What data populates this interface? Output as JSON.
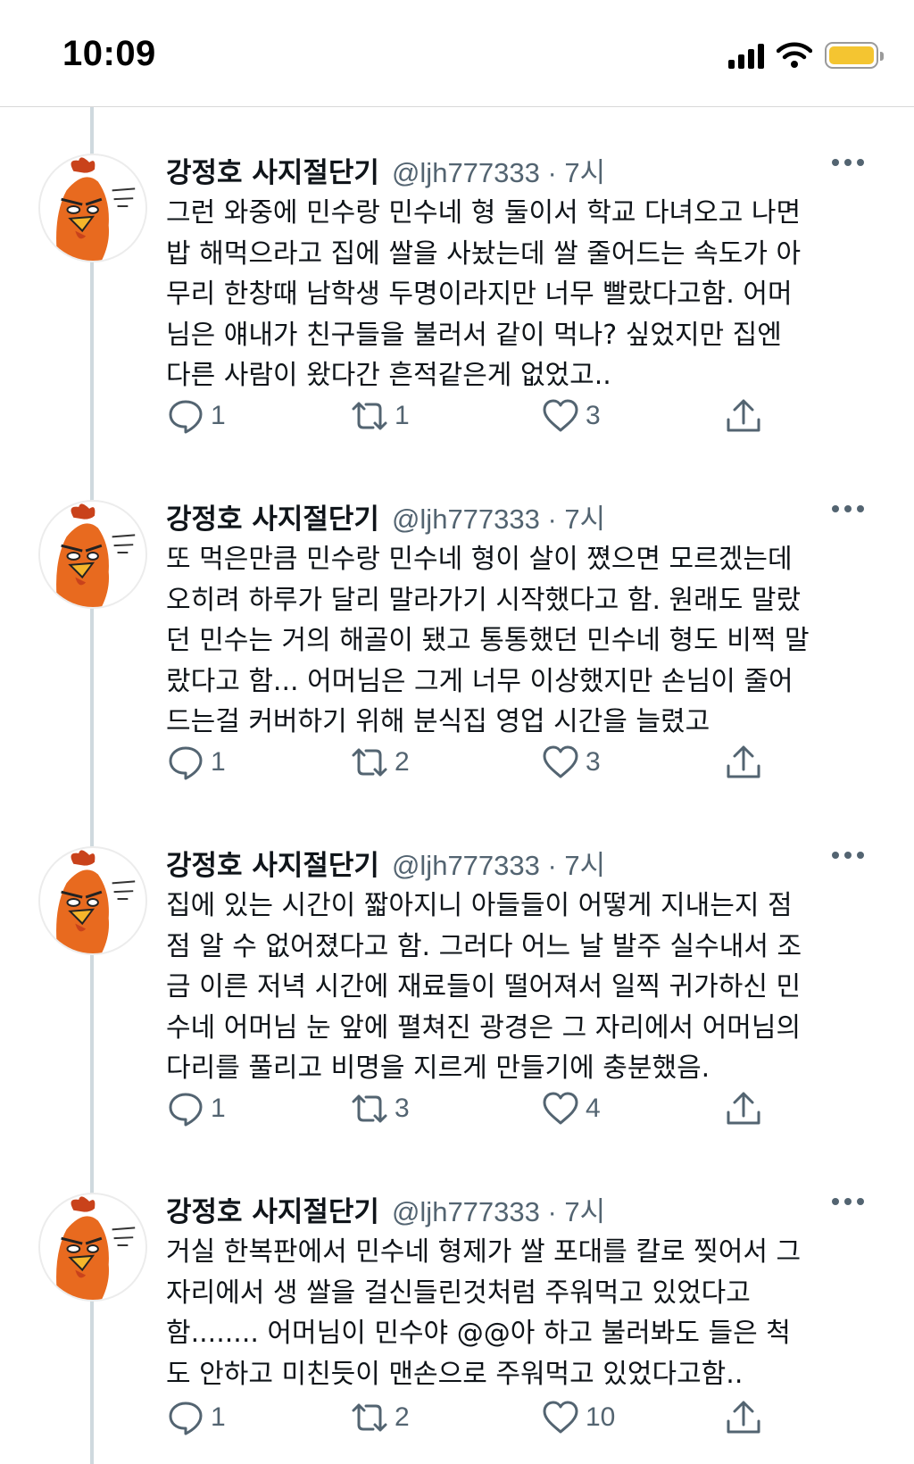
{
  "status_bar": {
    "time": "10:09",
    "battery_color": "#f4c531"
  },
  "colors": {
    "text": "#0f1419",
    "secondary": "#536471",
    "thread_line": "#cfd9de",
    "avatar_bird": "#e86a1f"
  },
  "tweets": [
    {
      "display_name": "강정호 사지절단기",
      "handle_time": "@ljh777333 · 7시",
      "text": "그런 와중에 민수랑 민수네 형 둘이서 학교 다녀오고 나면\n밥 해먹으라고 집에 쌀을 사놨는데 쌀 줄어드는 속도가 아\n무리 한창때 남학생 두명이라지만 너무 빨랐다고함. 어머\n님은 얘내가 친구들을 불러서 같이 먹나? 싶었지만 집엔\n다른 사람이 왔다간 흔적같은게 없었고..",
      "replies": "1",
      "retweets": "1",
      "likes": "3"
    },
    {
      "display_name": "강정호 사지절단기",
      "handle_time": "@ljh777333 · 7시",
      "text": "또 먹은만큼 민수랑 민수네 형이 살이 쪘으면 모르겠는데\n오히려 하루가 달리 말라가기 시작했다고 함. 원래도 말랐\n던 민수는 거의 해골이 됐고 통통했던 민수네 형도 비쩍 말\n랐다고 함... 어머님은 그게 너무 이상했지만 손님이 줄어\n드는걸 커버하기 위해 분식집 영업 시간을 늘렸고",
      "replies": "1",
      "retweets": "2",
      "likes": "3"
    },
    {
      "display_name": "강정호 사지절단기",
      "handle_time": "@ljh777333 · 7시",
      "text": "집에 있는 시간이 짧아지니 아들들이 어떻게 지내는지 점\n점 알 수 없어졌다고 함. 그러다 어느 날 발주 실수내서 조\n금 이른 저녁 시간에 재료들이 떨어져서 일찍 귀가하신 민\n수네 어머님 눈 앞에 펼쳐진 광경은 그 자리에서 어머님의\n다리를 풀리고 비명을 지르게 만들기에 충분했음.",
      "replies": "1",
      "retweets": "3",
      "likes": "4"
    },
    {
      "display_name": "강정호 사지절단기",
      "handle_time": "@ljh777333 · 7시",
      "text": "거실 한복판에서 민수네 형제가 쌀 포대를 칼로 찢어서 그\n자리에서 생 쌀을 걸신들린것처럼 주워먹고 있었다고\n함........ 어머님이 민수야 @@아 하고 불러봐도 들은 척\n도 안하고 미친듯이 맨손으로 주워먹고 있었다고함..",
      "replies": "1",
      "retweets": "2",
      "likes": "10"
    }
  ]
}
